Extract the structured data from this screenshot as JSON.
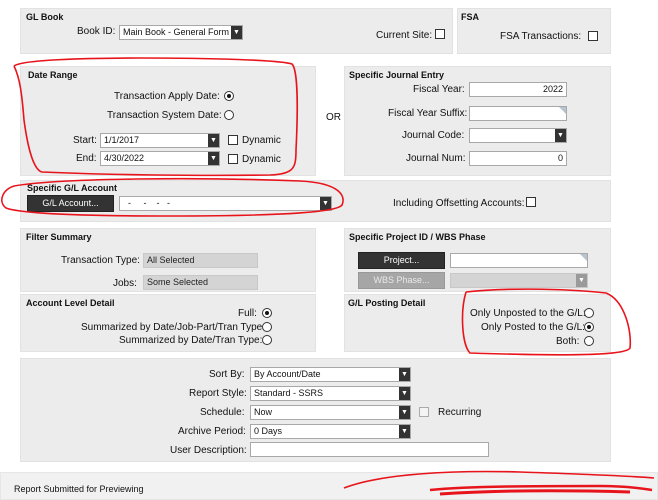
{
  "gl_book": {
    "heading": "GL Book",
    "book_id_label": "Book ID:",
    "book_id_value": "Main Book - General Form",
    "current_site_label": "Current Site:"
  },
  "fsa": {
    "heading": "FSA",
    "transactions_label": "FSA Transactions:"
  },
  "date_range": {
    "heading": "Date Range",
    "apply_date_label": "Transaction Apply Date:",
    "system_date_label": "Transaction System Date:",
    "start_label": "Start:",
    "start_value": "1/1/2017",
    "end_label": "End:",
    "end_value": "4/30/2022",
    "dynamic_label": "Dynamic",
    "selected": "apply"
  },
  "or_label": "OR",
  "journal": {
    "heading": "Specific Journal Entry",
    "fiscal_year_label": "Fiscal Year:",
    "fiscal_year_value": "2022",
    "suffix_label": "Fiscal Year Suffix:",
    "suffix_value": "",
    "code_label": "Journal Code:",
    "code_value": "",
    "num_label": "Journal Num:",
    "num_value": "0"
  },
  "gl_account": {
    "heading": "Specific G/L Account",
    "button_label": "G/L Account...",
    "value": "  -     -    -   -",
    "offsetting_label": "Including Offsetting Accounts:"
  },
  "filter_summary": {
    "heading": "Filter Summary",
    "transaction_type_label": "Transaction Type:",
    "transaction_type_value": "All Selected",
    "jobs_label": "Jobs:",
    "jobs_value": "Some Selected"
  },
  "project": {
    "heading": "Specific Project ID / WBS Phase",
    "project_button": "Project...",
    "wbs_button": "WBS Phase..."
  },
  "account_level": {
    "heading": "Account Level Detail",
    "full_label": "Full:",
    "summary_job_label": "Summarized by Date/Job-Part/Tran Type:",
    "summary_date_label": "Summarized by Date/Tran Type:",
    "selected": "full"
  },
  "posting": {
    "heading": "G/L Posting Detail",
    "unposted_label": "Only Unposted to the G/L:",
    "posted_label": "Only Posted to the G/L:",
    "both_label": "Both:",
    "selected": "posted"
  },
  "options": {
    "sort_by_label": "Sort By:",
    "sort_by_value": "By Account/Date",
    "report_style_label": "Report Style:",
    "report_style_value": "Standard - SSRS",
    "schedule_label": "Schedule:",
    "schedule_value": "Now",
    "recurring_label": "Recurring",
    "archive_label": "Archive Period:",
    "archive_value": "0 Days",
    "user_desc_label": "User Description:",
    "user_desc_value": ""
  },
  "status_text": "Report Submitted for Previewing",
  "colors": {
    "annotation_red": "#e8141c",
    "panel_bg": "#ececec",
    "button_dark": "#333333"
  }
}
